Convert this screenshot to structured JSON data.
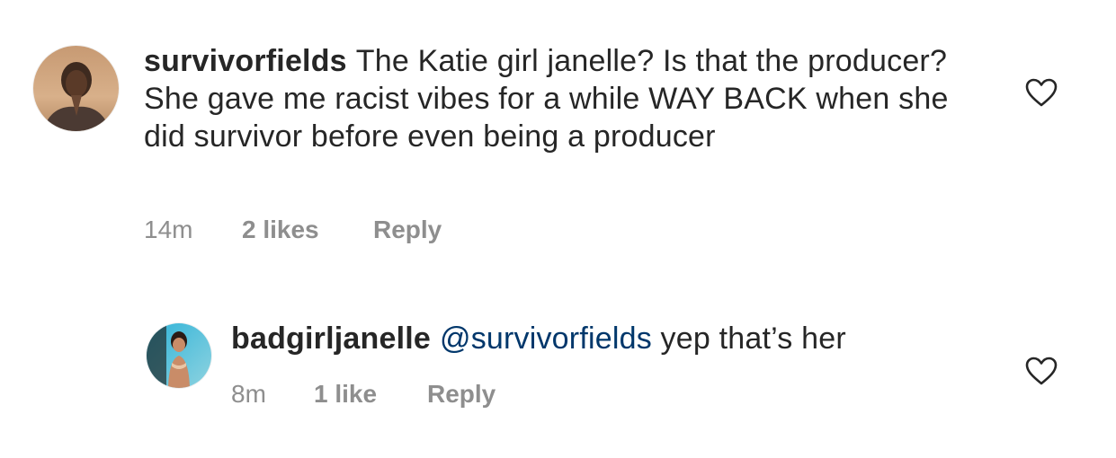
{
  "comments": [
    {
      "username": "survivorfields",
      "text": "The Katie girl janelle? Is that the producer? She gave me racist vibes for a while WAY BACK when she did survivor before even being a producer",
      "time": "14m",
      "likes": "2 likes",
      "reply_label": "Reply",
      "avatar_icon": "profile-photo"
    },
    {
      "username": "badgirljanelle",
      "mention": "@survivorfields",
      "text": "yep that’s her",
      "time": "8m",
      "likes": "1 like",
      "reply_label": "Reply",
      "avatar_icon": "profile-photo"
    }
  ],
  "icons": {
    "like": "heart-outline-icon"
  },
  "colors": {
    "text": "#262626",
    "meta": "#8e8e8e",
    "mention": "#00376b"
  }
}
